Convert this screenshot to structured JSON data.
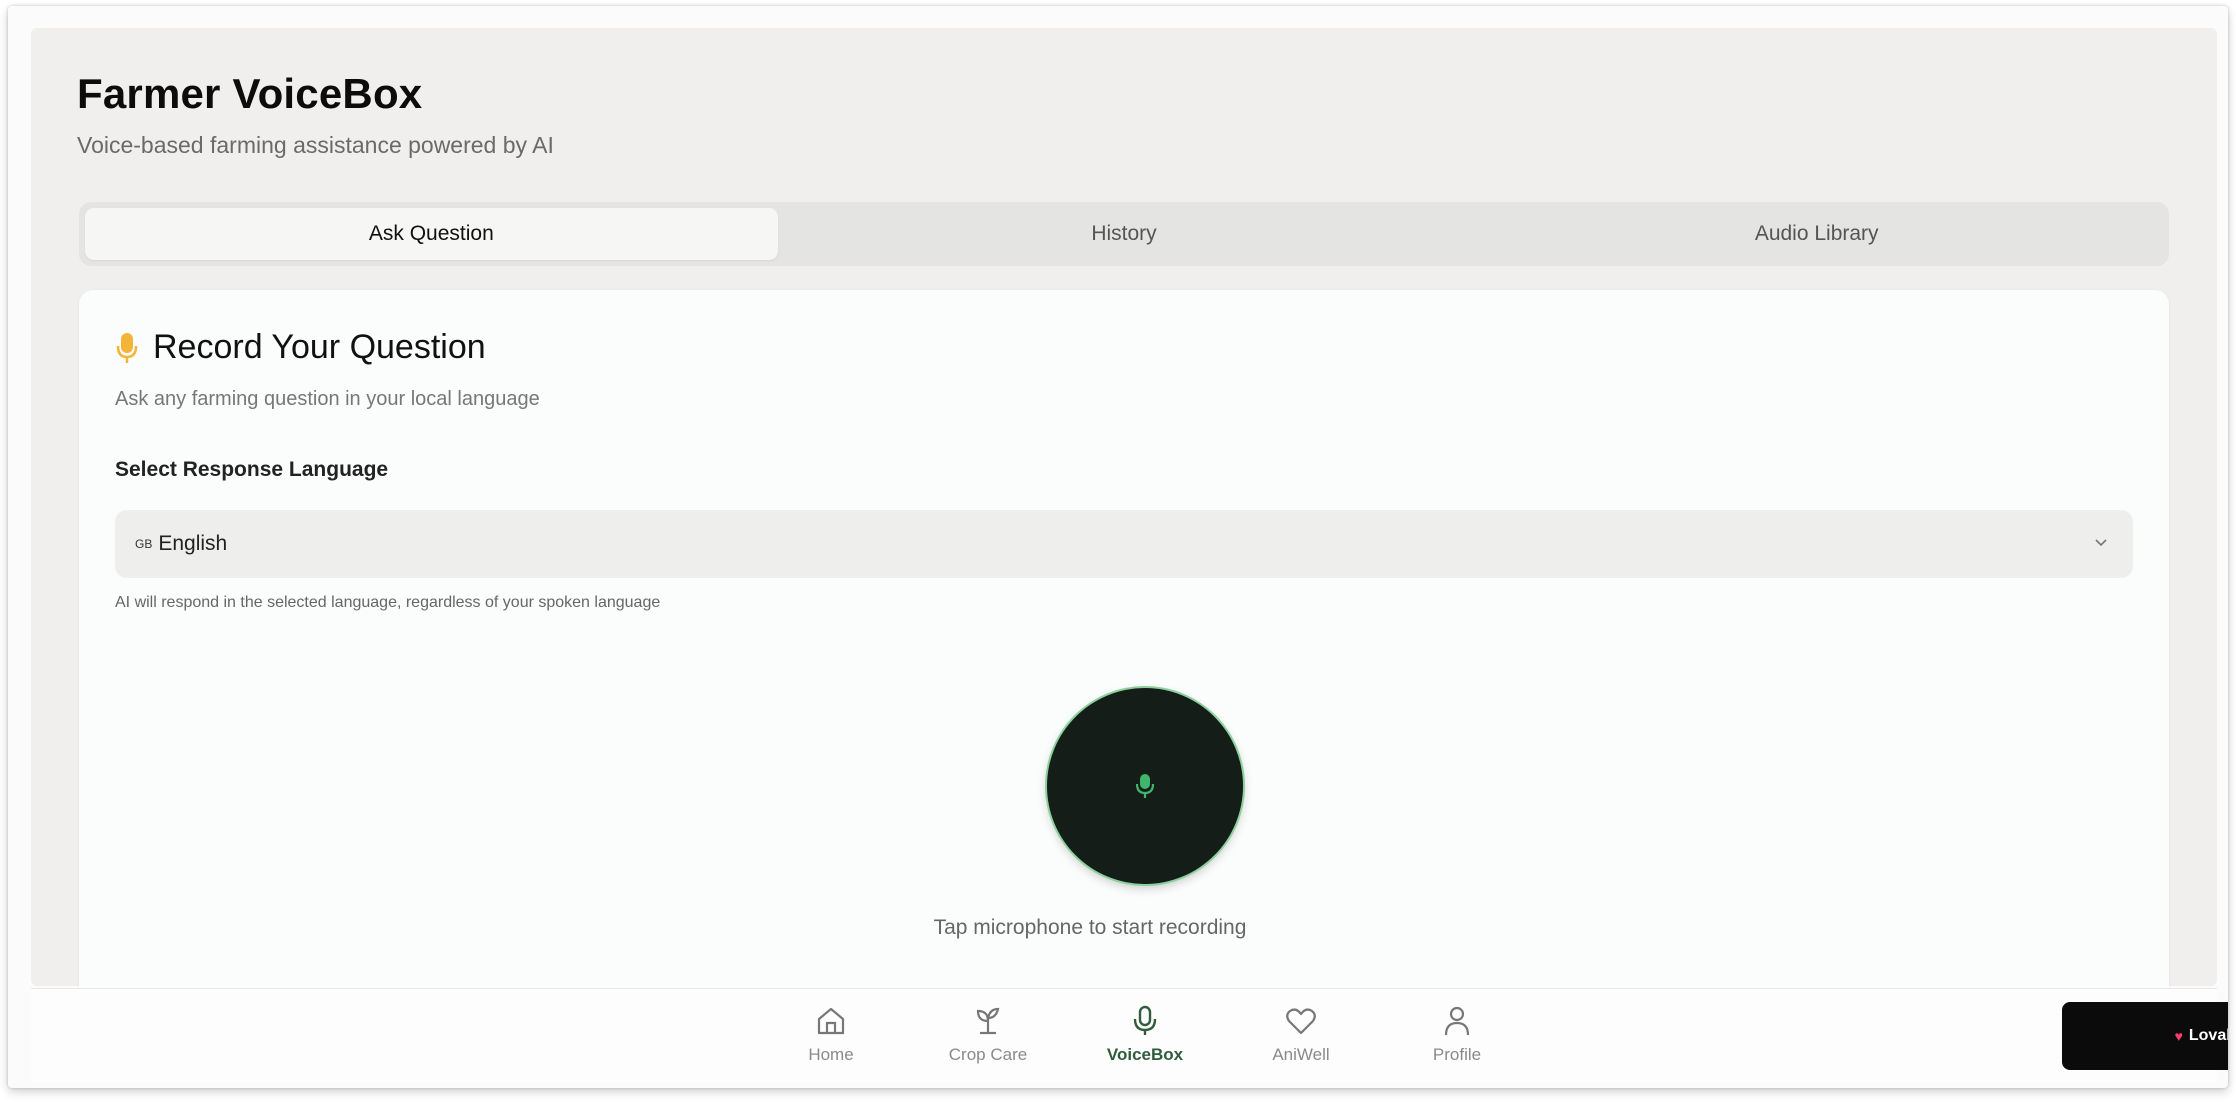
{
  "header": {
    "title": "Farmer VoiceBox",
    "subtitle": "Voice-based farming assistance powered by AI"
  },
  "tabs": [
    {
      "label": "Ask Question",
      "active": true
    },
    {
      "label": "History",
      "active": false
    },
    {
      "label": "Audio Library",
      "active": false
    }
  ],
  "card": {
    "icon": "microphone-icon",
    "title": "Record Your Question",
    "description": "Ask any farming question in your local language",
    "select_label": "Select Response Language",
    "select_flag": "GB",
    "select_value": "English",
    "select_hint": "AI will respond in the selected language, regardless of your spoken language",
    "record_hint": "Tap microphone to start recording"
  },
  "nav": [
    {
      "label": "Home",
      "icon": "home-icon",
      "active": false
    },
    {
      "label": "Crop Care",
      "icon": "sprout-icon",
      "active": false
    },
    {
      "label": "VoiceBox",
      "icon": "microphone-icon",
      "active": true
    },
    {
      "label": "AniWell",
      "icon": "heart-icon",
      "active": false
    },
    {
      "label": "Profile",
      "icon": "user-icon",
      "active": false
    }
  ],
  "badge": {
    "label": "Lovab"
  },
  "colors": {
    "accent": "#2f5d3c",
    "record_button": "#141d18",
    "mic_green": "#3fb66b",
    "mic_amber": "#f4b43a"
  }
}
